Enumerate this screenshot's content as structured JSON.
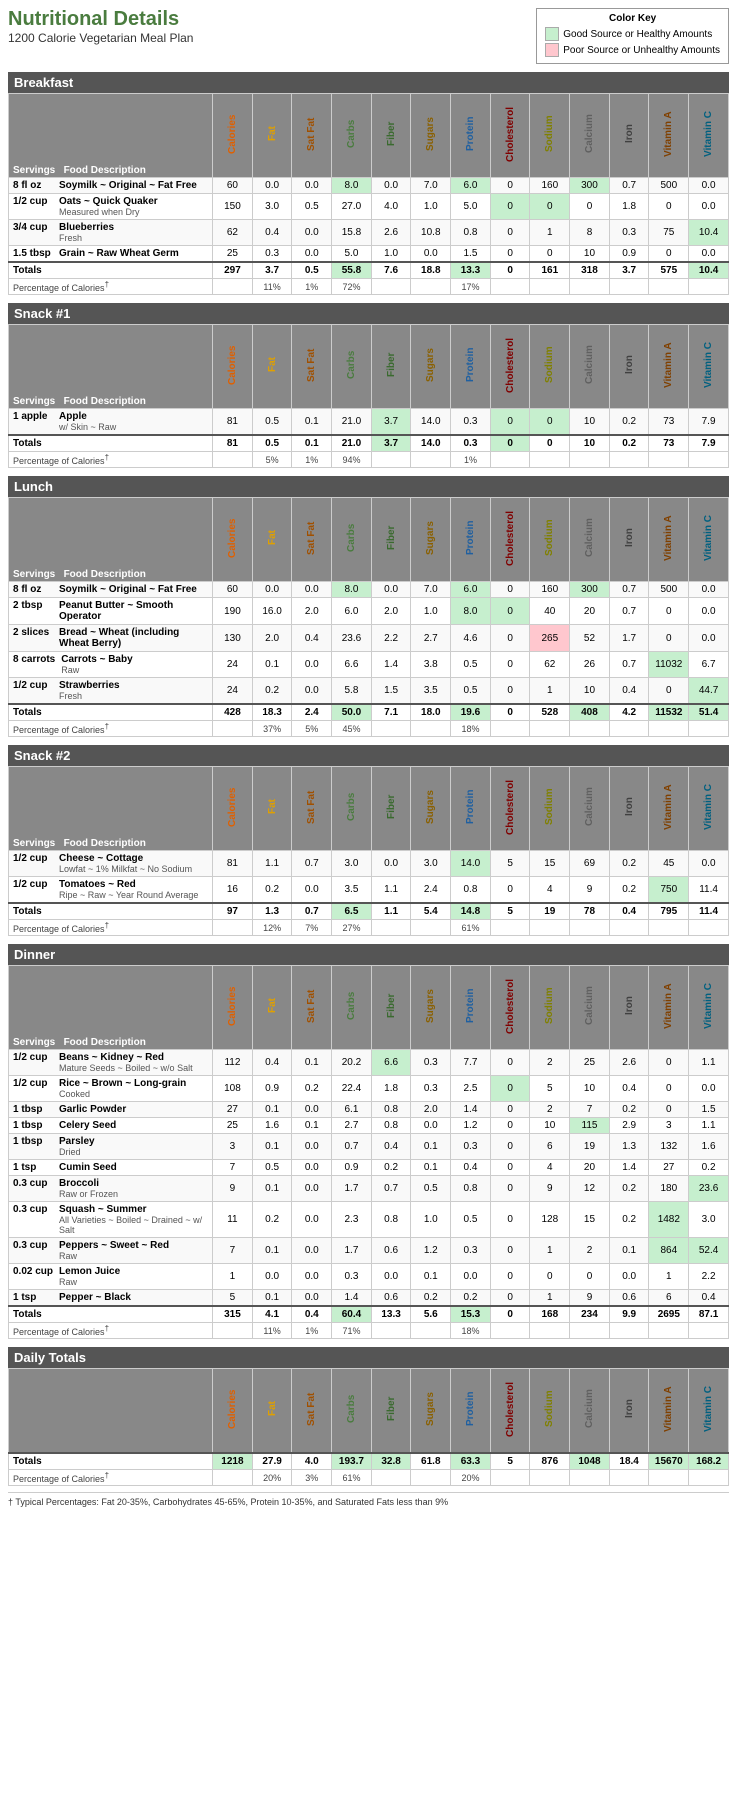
{
  "title": "Nutritional Details",
  "subtitle": "1200 Calorie Vegetarian Meal Plan",
  "colorKey": {
    "title": "Color Key",
    "good": "Good Source or Healthy Amounts",
    "poor": "Poor Source or Unhealthy Amounts"
  },
  "columns": [
    "Calories",
    "Fat",
    "Sat Fat",
    "Carbs",
    "Fiber",
    "Sugars",
    "Protein",
    "Cholesterol",
    "Sodium",
    "Calcium",
    "Iron",
    "Vitamin A",
    "Vitamin C"
  ],
  "sections": [
    {
      "name": "Breakfast",
      "rows": [
        {
          "serving": "8 fl oz",
          "food": "Soymilk ~ Original ~ Fat Free",
          "sub": "",
          "cal": "60",
          "fat": "0.0",
          "satfat": "0.0",
          "carbs": "8.0",
          "fiber": "0.0",
          "sugars": "7.0",
          "protein": "6.0",
          "chol": "0",
          "sodium": "160",
          "calcium": "300",
          "iron": "0.7",
          "vita": "500",
          "vitc": "0.0",
          "carbsGreen": true,
          "proteinGreen": true,
          "calciumGreen": true
        },
        {
          "serving": "1/2 cup",
          "food": "Oats ~ Quick Quaker",
          "sub": "Measured when Dry",
          "cal": "150",
          "fat": "3.0",
          "satfat": "0.5",
          "carbs": "27.0",
          "fiber": "4.0",
          "sugars": "1.0",
          "protein": "5.0",
          "chol": "0",
          "sodium": "0",
          "calcium": "0",
          "iron": "1.8",
          "vita": "0",
          "vitc": "0.0",
          "cholGreen": true,
          "sodiumGreen": true
        },
        {
          "serving": "3/4 cup",
          "food": "Blueberries",
          "sub": "Fresh",
          "cal": "62",
          "fat": "0.4",
          "satfat": "0.0",
          "carbs": "15.8",
          "fiber": "2.6",
          "sugars": "10.8",
          "protein": "0.8",
          "chol": "0",
          "sodium": "1",
          "calcium": "8",
          "iron": "0.3",
          "vita": "75",
          "vitc": "10.4",
          "vitcGreen": true
        },
        {
          "serving": "1.5 tbsp",
          "food": "Grain ~ Raw Wheat Germ",
          "sub": "",
          "cal": "25",
          "fat": "0.3",
          "satfat": "0.0",
          "carbs": "5.0",
          "fiber": "1.0",
          "sugars": "0.0",
          "protein": "1.5",
          "chol": "0",
          "sodium": "0",
          "calcium": "10",
          "iron": "0.9",
          "vita": "0",
          "vitc": "0.0"
        }
      ],
      "totals": {
        "cal": "297",
        "fat": "3.7",
        "satfat": "0.5",
        "carbs": "55.8",
        "fiber": "7.6",
        "sugars": "18.8",
        "protein": "13.3",
        "chol": "0",
        "sodium": "161",
        "calcium": "318",
        "iron": "3.7",
        "vita": "575",
        "vitc": "10.4",
        "carbsGreen": true,
        "proteinGreen": true,
        "vitcGreen": true
      },
      "pct": {
        "fat": "11%",
        "satfat": "1%",
        "carbs": "72%",
        "protein": "17%"
      }
    },
    {
      "name": "Snack #1",
      "rows": [
        {
          "serving": "1 apple",
          "food": "Apple",
          "sub": "w/ Skin ~ Raw",
          "cal": "81",
          "fat": "0.5",
          "satfat": "0.1",
          "carbs": "21.0",
          "fiber": "3.7",
          "sugars": "14.0",
          "protein": "0.3",
          "chol": "0",
          "sodium": "0",
          "calcium": "10",
          "iron": "0.2",
          "vita": "73",
          "vitc": "7.9",
          "fiberGreen": true,
          "cholGreen": true,
          "sodiumGreen": true
        }
      ],
      "totals": {
        "cal": "81",
        "fat": "0.5",
        "satfat": "0.1",
        "carbs": "21.0",
        "fiber": "3.7",
        "sugars": "14.0",
        "protein": "0.3",
        "chol": "0",
        "sodium": "0",
        "calcium": "10",
        "iron": "0.2",
        "vita": "73",
        "vitc": "7.9",
        "fiberGreen": true,
        "cholGreen": true,
        "sodiumGreen": true
      },
      "pct": {
        "fat": "5%",
        "satfat": "1%",
        "carbs": "94%",
        "protein": "1%"
      }
    },
    {
      "name": "Lunch",
      "rows": [
        {
          "serving": "8 fl oz",
          "food": "Soymilk ~ Original ~ Fat Free",
          "sub": "",
          "cal": "60",
          "fat": "0.0",
          "satfat": "0.0",
          "carbs": "8.0",
          "fiber": "0.0",
          "sugars": "7.0",
          "protein": "6.0",
          "chol": "0",
          "sodium": "160",
          "calcium": "300",
          "iron": "0.7",
          "vita": "500",
          "vitc": "0.0",
          "carbsGreen": true,
          "proteinGreen": true,
          "calciumGreen": true
        },
        {
          "serving": "2 tbsp",
          "food": "Peanut Butter ~ Smooth Operator",
          "sub": "",
          "cal": "190",
          "fat": "16.0",
          "satfat": "2.0",
          "carbs": "6.0",
          "fiber": "2.0",
          "sugars": "1.0",
          "protein": "8.0",
          "chol": "0",
          "sodium": "40",
          "calcium": "20",
          "iron": "0.7",
          "vita": "0",
          "vitc": "0.0",
          "proteinGreen": true,
          "cholGreen": true
        },
        {
          "serving": "2 slices",
          "food": "Bread ~ Wheat (including Wheat Berry)",
          "sub": "",
          "cal": "130",
          "fat": "2.0",
          "satfat": "0.4",
          "carbs": "23.6",
          "fiber": "2.2",
          "sugars": "2.7",
          "protein": "4.6",
          "chol": "0",
          "sodium": "265",
          "calcium": "52",
          "iron": "1.7",
          "vita": "0",
          "vitc": "0.0",
          "sodiumPink": true
        },
        {
          "serving": "8 carrots",
          "food": "Carrots ~ Baby",
          "sub": "Raw",
          "cal": "24",
          "fat": "0.1",
          "satfat": "0.0",
          "carbs": "6.6",
          "fiber": "1.4",
          "sugars": "3.8",
          "protein": "0.5",
          "chol": "0",
          "sodium": "62",
          "calcium": "26",
          "iron": "0.7",
          "vita": "11032",
          "vitc": "6.7",
          "vitaGreen": true
        },
        {
          "serving": "1/2 cup",
          "food": "Strawberries",
          "sub": "Fresh",
          "cal": "24",
          "fat": "0.2",
          "satfat": "0.0",
          "carbs": "5.8",
          "fiber": "1.5",
          "sugars": "3.5",
          "protein": "0.5",
          "chol": "0",
          "sodium": "1",
          "calcium": "10",
          "iron": "0.4",
          "vita": "0",
          "vitc": "44.7",
          "vitcGreen": true
        }
      ],
      "totals": {
        "cal": "428",
        "fat": "18.3",
        "satfat": "2.4",
        "carbs": "50.0",
        "fiber": "7.1",
        "sugars": "18.0",
        "protein": "19.6",
        "chol": "0",
        "sodium": "528",
        "calcium": "408",
        "iron": "4.2",
        "vita": "11532",
        "vitc": "51.4",
        "carbsGreen": true,
        "proteinGreen": true,
        "calciumGreen": true,
        "vitaGreen": true,
        "vitcGreen": true
      },
      "pct": {
        "fat": "37%",
        "satfat": "5%",
        "carbs": "45%",
        "protein": "18%"
      }
    },
    {
      "name": "Snack #2",
      "rows": [
        {
          "serving": "1/2 cup",
          "food": "Cheese ~ Cottage",
          "sub": "Lowfat ~ 1% Milkfat ~ No Sodium",
          "cal": "81",
          "fat": "1.1",
          "satfat": "0.7",
          "carbs": "3.0",
          "fiber": "0.0",
          "sugars": "3.0",
          "protein": "14.0",
          "chol": "5",
          "sodium": "15",
          "calcium": "69",
          "iron": "0.2",
          "vita": "45",
          "vitc": "0.0",
          "proteinGreen": true
        },
        {
          "serving": "1/2 cup",
          "food": "Tomatoes ~ Red",
          "sub": "Ripe ~ Raw ~ Year Round Average",
          "cal": "16",
          "fat": "0.2",
          "satfat": "0.0",
          "carbs": "3.5",
          "fiber": "1.1",
          "sugars": "2.4",
          "protein": "0.8",
          "chol": "0",
          "sodium": "4",
          "calcium": "9",
          "iron": "0.2",
          "vita": "750",
          "vitc": "11.4",
          "vitaGreen": true
        }
      ],
      "totals": {
        "cal": "97",
        "fat": "1.3",
        "satfat": "0.7",
        "carbs": "6.5",
        "fiber": "1.1",
        "sugars": "5.4",
        "protein": "14.8",
        "chol": "5",
        "sodium": "19",
        "calcium": "78",
        "iron": "0.4",
        "vita": "795",
        "vitc": "11.4",
        "carbsGreen": true,
        "proteinGreen": true
      },
      "pct": {
        "fat": "12%",
        "satfat": "7%",
        "carbs": "27%",
        "protein": "61%"
      }
    },
    {
      "name": "Dinner",
      "rows": [
        {
          "serving": "1/2 cup",
          "food": "Beans ~ Kidney ~ Red",
          "sub": "Mature Seeds ~ Boiled ~ w/o Salt",
          "cal": "112",
          "fat": "0.4",
          "satfat": "0.1",
          "carbs": "20.2",
          "fiber": "6.6",
          "sugars": "0.3",
          "protein": "7.7",
          "chol": "0",
          "sodium": "2",
          "calcium": "25",
          "iron": "2.6",
          "vita": "0",
          "vitc": "1.1",
          "fiberGreen": true
        },
        {
          "serving": "1/2 cup",
          "food": "Rice ~ Brown ~ Long-grain",
          "sub": "Cooked",
          "cal": "108",
          "fat": "0.9",
          "satfat": "0.2",
          "carbs": "22.4",
          "fiber": "1.8",
          "sugars": "0.3",
          "protein": "2.5",
          "chol": "0",
          "sodium": "5",
          "calcium": "10",
          "iron": "0.4",
          "vita": "0",
          "vitc": "0.0",
          "cholGreen": true
        },
        {
          "serving": "1 tbsp",
          "food": "Garlic Powder",
          "sub": "",
          "cal": "27",
          "fat": "0.1",
          "satfat": "0.0",
          "carbs": "6.1",
          "fiber": "0.8",
          "sugars": "2.0",
          "protein": "1.4",
          "chol": "0",
          "sodium": "2",
          "calcium": "7",
          "iron": "0.2",
          "vita": "0",
          "vitc": "1.5"
        },
        {
          "serving": "1 tbsp",
          "food": "Celery Seed",
          "sub": "",
          "cal": "25",
          "fat": "1.6",
          "satfat": "0.1",
          "carbs": "2.7",
          "fiber": "0.8",
          "sugars": "0.0",
          "protein": "1.2",
          "chol": "0",
          "sodium": "10",
          "calcium": "115",
          "iron": "2.9",
          "vita": "3",
          "vitc": "1.1",
          "calciumGreen": true
        },
        {
          "serving": "1 tbsp",
          "food": "Parsley",
          "sub": "Dried",
          "cal": "3",
          "fat": "0.1",
          "satfat": "0.0",
          "carbs": "0.7",
          "fiber": "0.4",
          "sugars": "0.1",
          "protein": "0.3",
          "chol": "0",
          "sodium": "6",
          "calcium": "19",
          "iron": "1.3",
          "vita": "132",
          "vitc": "1.6"
        },
        {
          "serving": "1 tsp",
          "food": "Cumin Seed",
          "sub": "",
          "cal": "7",
          "fat": "0.5",
          "satfat": "0.0",
          "carbs": "0.9",
          "fiber": "0.2",
          "sugars": "0.1",
          "protein": "0.4",
          "chol": "0",
          "sodium": "4",
          "calcium": "20",
          "iron": "1.4",
          "vita": "27",
          "vitc": "0.2"
        },
        {
          "serving": "0.3 cup",
          "food": "Broccoli",
          "sub": "Raw or Frozen",
          "cal": "9",
          "fat": "0.1",
          "satfat": "0.0",
          "carbs": "1.7",
          "fiber": "0.7",
          "sugars": "0.5",
          "protein": "0.8",
          "chol": "0",
          "sodium": "9",
          "calcium": "12",
          "iron": "0.2",
          "vita": "180",
          "vitc": "23.6",
          "vitcGreen": true
        },
        {
          "serving": "0.3 cup",
          "food": "Squash ~ Summer",
          "sub": "All Varieties ~ Boiled ~ Drained ~ w/ Salt",
          "cal": "11",
          "fat": "0.2",
          "satfat": "0.0",
          "carbs": "2.3",
          "fiber": "0.8",
          "sugars": "1.0",
          "protein": "0.5",
          "chol": "0",
          "sodium": "128",
          "calcium": "15",
          "iron": "0.2",
          "vita": "1482",
          "vitc": "3.0",
          "vitaGreen": true
        },
        {
          "serving": "0.3 cup",
          "food": "Peppers ~ Sweet ~ Red",
          "sub": "Raw",
          "cal": "7",
          "fat": "0.1",
          "satfat": "0.0",
          "carbs": "1.7",
          "fiber": "0.6",
          "sugars": "1.2",
          "protein": "0.3",
          "chol": "0",
          "sodium": "1",
          "calcium": "2",
          "iron": "0.1",
          "vita": "864",
          "vitc": "52.4",
          "vitaGreen": true,
          "vitcGreen": true
        },
        {
          "serving": "0.02 cup",
          "food": "Lemon Juice",
          "sub": "Raw",
          "cal": "1",
          "fat": "0.0",
          "satfat": "0.0",
          "carbs": "0.3",
          "fiber": "0.0",
          "sugars": "0.1",
          "protein": "0.0",
          "chol": "0",
          "sodium": "0",
          "calcium": "0",
          "iron": "0.0",
          "vita": "1",
          "vitc": "2.2"
        },
        {
          "serving": "1 tsp",
          "food": "Pepper ~ Black",
          "sub": "",
          "cal": "5",
          "fat": "0.1",
          "satfat": "0.0",
          "carbs": "1.4",
          "fiber": "0.6",
          "sugars": "0.2",
          "protein": "0.2",
          "chol": "0",
          "sodium": "1",
          "calcium": "9",
          "iron": "0.6",
          "vita": "6",
          "vitc": "0.4"
        }
      ],
      "totals": {
        "cal": "315",
        "fat": "4.1",
        "satfat": "0.4",
        "carbs": "60.4",
        "fiber": "13.3",
        "sugars": "5.6",
        "protein": "15.3",
        "chol": "0",
        "sodium": "168",
        "calcium": "234",
        "iron": "9.9",
        "vita": "2695",
        "vitc": "87.1",
        "carbsGreen": true,
        "proteinGreen": true
      },
      "pct": {
        "fat": "11%",
        "satfat": "1%",
        "carbs": "71%",
        "protein": "18%"
      }
    }
  ],
  "dailyTotals": {
    "cal": "1218",
    "fat": "27.9",
    "satfat": "4.0",
    "carbs": "193.7",
    "fiber": "32.8",
    "sugars": "61.8",
    "protein": "63.3",
    "chol": "5",
    "sodium": "876",
    "calcium": "1048",
    "iron": "18.4",
    "vita": "15670",
    "vitc": "168.2",
    "pct": {
      "fat": "20%",
      "satfat": "3%",
      "carbs": "61%",
      "protein": "20%"
    }
  },
  "footnote": "† Typical Percentages: Fat 20-35%, Carbohydrates 45-65%, Protein 10-35%, and Saturated Fats less than 9%"
}
